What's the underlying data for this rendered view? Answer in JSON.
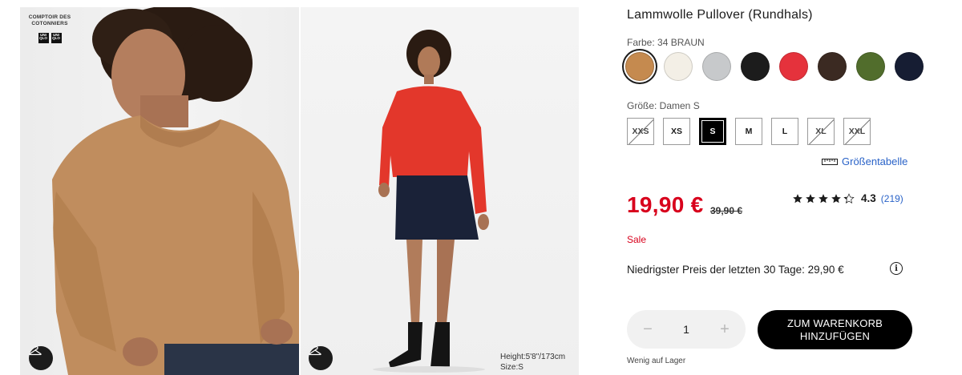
{
  "gallery": {
    "brand_text": "COMPTOIR DES COTONNIERS",
    "brand_logo_1": "UNI QLO",
    "brand_logo_2": "UNI QLO",
    "model_height": "Height:5'8\"/173cm",
    "model_size": "Size:S"
  },
  "product": {
    "title": "Lammwolle Pullover (Rundhals)",
    "color_label": "Farbe: 34 BRAUN",
    "colors": [
      {
        "name": "braun",
        "hex": "#c58a4f",
        "selected": true
      },
      {
        "name": "off-white",
        "hex": "#f3efe6",
        "selected": false
      },
      {
        "name": "grau",
        "hex": "#c7c9cb",
        "selected": false
      },
      {
        "name": "schwarz",
        "hex": "#1c1c1c",
        "selected": false
      },
      {
        "name": "rot",
        "hex": "#e5323c",
        "selected": false
      },
      {
        "name": "dunkelbraun",
        "hex": "#3b2a22",
        "selected": false
      },
      {
        "name": "olive",
        "hex": "#516d2c",
        "selected": false
      },
      {
        "name": "navy",
        "hex": "#161d33",
        "selected": false
      }
    ],
    "size_label": "Größe: Damen S",
    "sizes": [
      {
        "label": "XXS",
        "available": false,
        "selected": false
      },
      {
        "label": "XS",
        "available": true,
        "selected": false
      },
      {
        "label": "S",
        "available": true,
        "selected": true
      },
      {
        "label": "M",
        "available": true,
        "selected": false
      },
      {
        "label": "L",
        "available": true,
        "selected": false
      },
      {
        "label": "XL",
        "available": false,
        "selected": false
      },
      {
        "label": "XXL",
        "available": false,
        "selected": false
      }
    ],
    "size_chart_label": "Größentabelle",
    "price": "19,90 €",
    "old_price": "39,90 €",
    "rating_value": "4.3",
    "rating_stars": 4.3,
    "rating_count": "(219)",
    "sale_label": "Sale",
    "lowest_price_text": "Niedrigster Preis der letzten 30 Tage: 29,90 €",
    "quantity": "1",
    "add_to_cart_label": "ZUM WARENKORB HINZUFÜGEN",
    "stock_text": "Wenig auf Lager"
  },
  "colors": {
    "sale_red": "#d8001c",
    "link_blue": "#2a63c8",
    "button_black": "#000000"
  }
}
